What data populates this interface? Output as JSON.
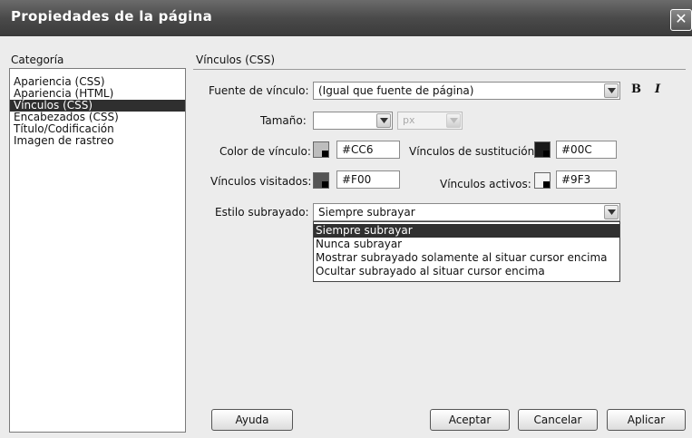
{
  "window": {
    "title": "Propiedades de la página",
    "close_glyph": "✕"
  },
  "category": {
    "heading": "Categoría",
    "items": [
      {
        "label": "Apariencia (CSS)",
        "selected": false
      },
      {
        "label": "Apariencia (HTML)",
        "selected": false
      },
      {
        "label": "Vínculos (CSS)",
        "selected": true
      },
      {
        "label": "Encabezados (CSS)",
        "selected": false
      },
      {
        "label": "Título/Codificación",
        "selected": false
      },
      {
        "label": "Imagen de rastreo",
        "selected": false
      }
    ]
  },
  "panel": {
    "heading": "Vínculos (CSS)",
    "link_font": {
      "label": "Fuente de vínculo:",
      "value": "(Igual que fuente de página)",
      "bold": "B",
      "italic": "I"
    },
    "size": {
      "label": "Tamaño:",
      "value": "",
      "unit": "px"
    },
    "link_color": {
      "label": "Color de vínculo:",
      "value": "#CC6",
      "swatch": "#cccc66"
    },
    "rollover_color": {
      "label": "Vínculos de sustitución:",
      "value": "#00C",
      "swatch": "#0000cc"
    },
    "visited_color": {
      "label": "Vínculos visitados:",
      "value": "#F00",
      "swatch": "#ff0000"
    },
    "active_color": {
      "label": "Vínculos activos:",
      "value": "#9F3",
      "swatch": "#99ff33"
    },
    "underline": {
      "label": "Estilo subrayado:",
      "value": "Siempre subrayar",
      "options": [
        {
          "label": "Siempre subrayar",
          "selected": true
        },
        {
          "label": "Nunca subrayar",
          "selected": false
        },
        {
          "label": "Mostrar subrayado solamente al situar cursor encima",
          "selected": false
        },
        {
          "label": "Ocultar subrayado al situar cursor encima",
          "selected": false
        }
      ]
    }
  },
  "buttons": {
    "help": "Ayuda",
    "ok": "Aceptar",
    "cancel": "Cancelar",
    "apply": "Aplicar"
  }
}
